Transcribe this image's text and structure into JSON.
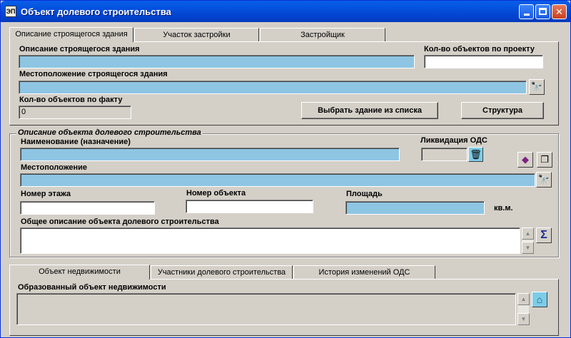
{
  "window": {
    "title": "Объект долевого строительства",
    "app_icon": "ЭП"
  },
  "top_tabs": [
    {
      "label": "Описание строящегося здания",
      "active": true
    },
    {
      "label": "Участок застройки",
      "active": false
    },
    {
      "label": "Застройщик",
      "active": false
    }
  ],
  "building": {
    "description_label": "Описание строящегося здания",
    "description_value": "",
    "count_by_project_label": "Кол-во объектов по проекту",
    "count_by_project_value": "",
    "location_label": "Местоположение строящегося здания",
    "location_value": "",
    "count_actual_label": "Кол-во объектов по факту",
    "count_actual_value": "0",
    "select_building_button": "Выбрать здание из списка",
    "structure_button": "Структура"
  },
  "ods_group": {
    "title": "Описание объекта долевого строительства",
    "name_label": "Наименование (назначение)",
    "name_value": "",
    "liquidation_label": "Ликвидация ОДС",
    "liquidation_value": "",
    "location_label": "Местоположение",
    "location_value": "",
    "floor_label": "Номер этажа",
    "floor_value": "",
    "object_number_label": "Номер объекта",
    "object_number_value": "",
    "area_label": "Площадь",
    "area_value": "",
    "area_unit": "кв.м.",
    "general_description_label": "Общее описание объекта долевого строительства",
    "general_description_value": ""
  },
  "bottom_tabs": [
    {
      "label": "Объект недвижимости",
      "active": true
    },
    {
      "label": "Участники долевого строительства",
      "active": false
    },
    {
      "label": "История изменений ОДС",
      "active": false
    }
  ],
  "real_estate": {
    "label": "Образованный объект недвижимости",
    "value": ""
  },
  "colors": {
    "field_blue": "#8ec5e3",
    "face": "#d4d0c8",
    "title_bar": "#0454e0"
  }
}
